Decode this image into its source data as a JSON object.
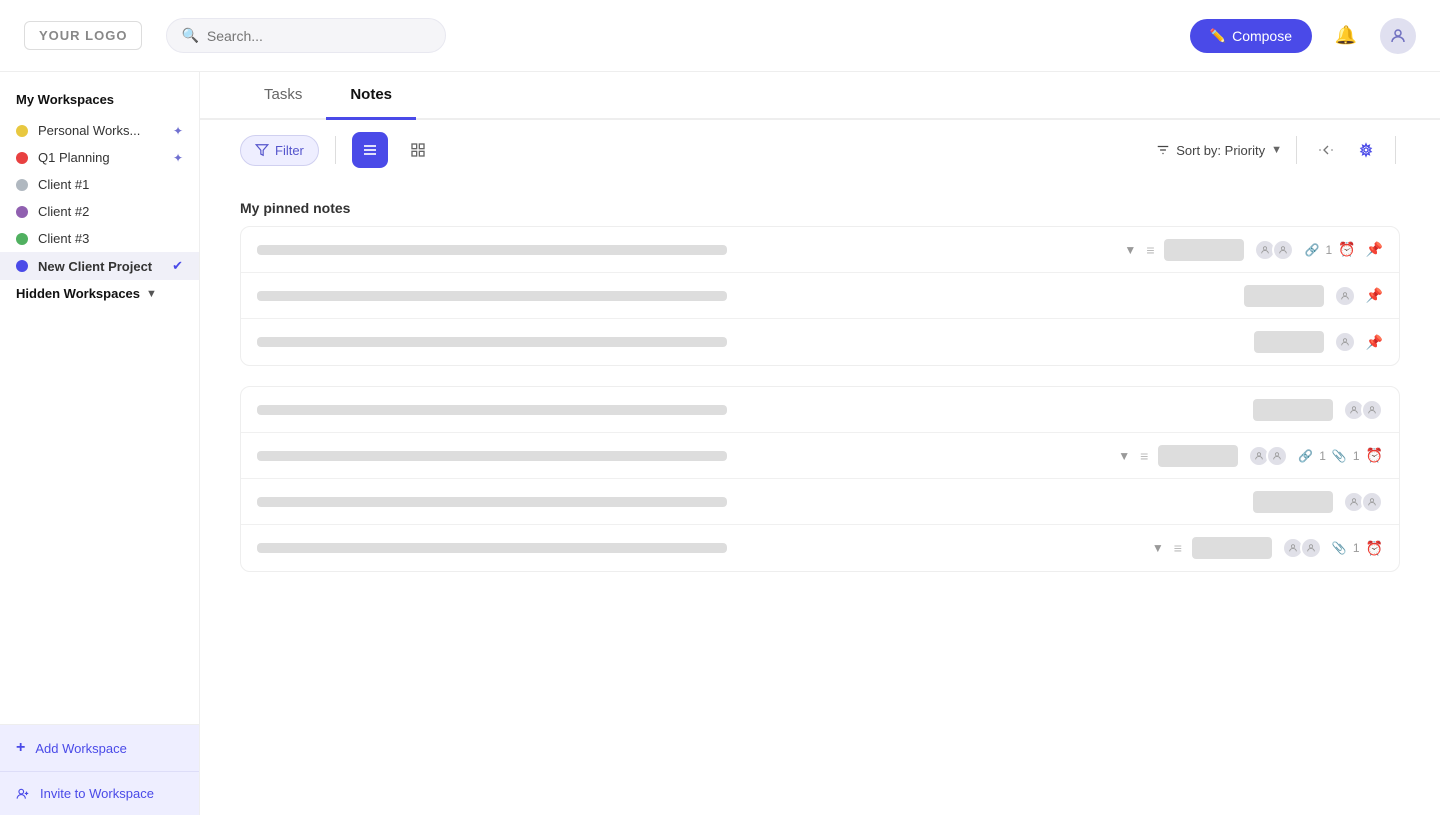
{
  "header": {
    "logo": "YOUR LOGO",
    "search_placeholder": "Search...",
    "compose_label": "Compose"
  },
  "sidebar": {
    "section_title": "My Workspaces",
    "workspaces": [
      {
        "id": "personal",
        "label": "Personal Works...",
        "color": "#e8c840",
        "pinned": true,
        "active": false
      },
      {
        "id": "q1",
        "label": "Q1 Planning",
        "color": "#e84040",
        "pinned": true,
        "active": false
      },
      {
        "id": "client1",
        "label": "Client #1",
        "color": "#b0b8c0",
        "pinned": false,
        "active": false
      },
      {
        "id": "client2",
        "label": "Client #2",
        "color": "#9060b0",
        "pinned": false,
        "active": false
      },
      {
        "id": "client3",
        "label": "Client #3",
        "color": "#50b060",
        "pinned": false,
        "active": false
      },
      {
        "id": "newclient",
        "label": "New Client Project",
        "color": "#4a4ae8",
        "checked": true,
        "active": true
      }
    ],
    "hidden_workspaces_label": "Hidden Workspaces",
    "add_workspace_label": "Add Workspace",
    "invite_label": "Invite to Workspace"
  },
  "tabs": [
    {
      "id": "tasks",
      "label": "Tasks",
      "active": false
    },
    {
      "id": "notes",
      "label": "Notes",
      "active": true
    }
  ],
  "toolbar": {
    "filter_label": "Filter",
    "sort_label": "Sort by: Priority"
  },
  "notes": {
    "pinned_title": "My pinned notes",
    "pinned_rows": [
      {
        "id": "p1",
        "text_width": 470,
        "has_chevron": true,
        "has_menu": true,
        "tag_width": 80,
        "avatars": 2,
        "link": true,
        "clock": true,
        "pinned": true
      },
      {
        "id": "p2",
        "text_width": 470,
        "has_chevron": false,
        "has_menu": false,
        "tag_width": 80,
        "avatars": 1,
        "link": false,
        "clock": false,
        "pinned": true
      },
      {
        "id": "p3",
        "text_width": 470,
        "has_chevron": false,
        "has_menu": false,
        "tag_width": 70,
        "avatars": 1,
        "link": false,
        "clock": false,
        "pinned": true
      }
    ],
    "unpinned_rows": [
      {
        "id": "u1",
        "text_width": 470,
        "has_chevron": false,
        "has_menu": false,
        "tag_width": 80,
        "avatars": 2,
        "link": false,
        "clock": false,
        "pinned": false
      },
      {
        "id": "u2",
        "text_width": 470,
        "has_chevron": true,
        "has_menu": true,
        "tag_width": 80,
        "avatars": 2,
        "link": true,
        "attach": true,
        "clock": true,
        "pinned": false
      },
      {
        "id": "u3",
        "text_width": 470,
        "has_chevron": false,
        "has_menu": false,
        "tag_width": 80,
        "avatars": 2,
        "link": false,
        "clock": false,
        "pinned": false
      },
      {
        "id": "u4",
        "text_width": 470,
        "has_chevron": true,
        "has_menu": true,
        "tag_width": 80,
        "avatars": 2,
        "attach": true,
        "clock": true,
        "pinned": false
      }
    ]
  }
}
